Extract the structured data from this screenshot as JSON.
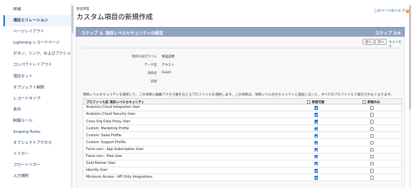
{
  "sidebar": {
    "items": [
      {
        "label": "詳細"
      },
      {
        "label": "項目とリレーション"
      },
      {
        "label": "ページレイアウト"
      },
      {
        "label": "Lightning レコードページ"
      },
      {
        "label": "ボタン、リンク、およびアクション"
      },
      {
        "label": "コンパクトレイアウト"
      },
      {
        "label": "項目セット"
      },
      {
        "label": "オブジェクト制限"
      },
      {
        "label": "レコードタイプ"
      },
      {
        "label": "条件"
      },
      {
        "label": "制御ルール"
      },
      {
        "label": "Scoping Rules"
      },
      {
        "label": "オブジェクトアクセス"
      },
      {
        "label": "トリガー"
      },
      {
        "label": "フロートリガー"
      },
      {
        "label": "入力規則"
      }
    ]
  },
  "header": {
    "eyebrow": "製品管理",
    "title": "カスタム項目の新規作成",
    "help_link": "このページのヘルプ",
    "help_icon_glyph": "?"
  },
  "step": {
    "title": "ステップ 3. 項目レベルセキュリティの設定",
    "number": "ステップ 3/4"
  },
  "actions": {
    "prev_label": "前へ",
    "next_label": "次へ",
    "cancel_label": "キャンセル"
  },
  "field_info": {
    "display_label_label": "項目の表示ラベル",
    "display_label_value": "製品説明",
    "data_type_label": "データ型",
    "data_type_value": "テキスト",
    "field_name_label": "項目名",
    "field_name_value": "Field1",
    "description_label": "説明",
    "description_value": ""
  },
  "description": "項目レベルセキュリティを選択して、この項目に編集アクセス権を与えるプロファイルを選択します。この項目は、項目レベルのセキュリティに追加しないと、すべてのプロファイルで表示されなくなります。",
  "table": {
    "col_profile": "プロファイル別 項目レベルセキュリティ",
    "col_visible": "参照可能",
    "col_readonly": "参照のみ",
    "rows": [
      {
        "name": "Analytics Cloud Integration User"
      },
      {
        "name": "Analytics Cloud Security User"
      },
      {
        "name": "Cross Org Data Proxy User"
      },
      {
        "name": "Custom: Marketing Profile"
      },
      {
        "name": "Custom: Sales Profile"
      },
      {
        "name": "Custom: Support Profile"
      },
      {
        "name": "Force.com - App Subscription User"
      },
      {
        "name": "Force.com - Free User"
      },
      {
        "name": "Gold Partner User"
      },
      {
        "name": "Identity User"
      },
      {
        "name": "Minimum Access - API Only Integrations"
      }
    ]
  },
  "colors": {
    "step_bar": "#8fa3c1",
    "link": "#015ba7",
    "checkbox_checked": "#1f6fd8",
    "sidebar_active_bg": "#eef4fb"
  }
}
